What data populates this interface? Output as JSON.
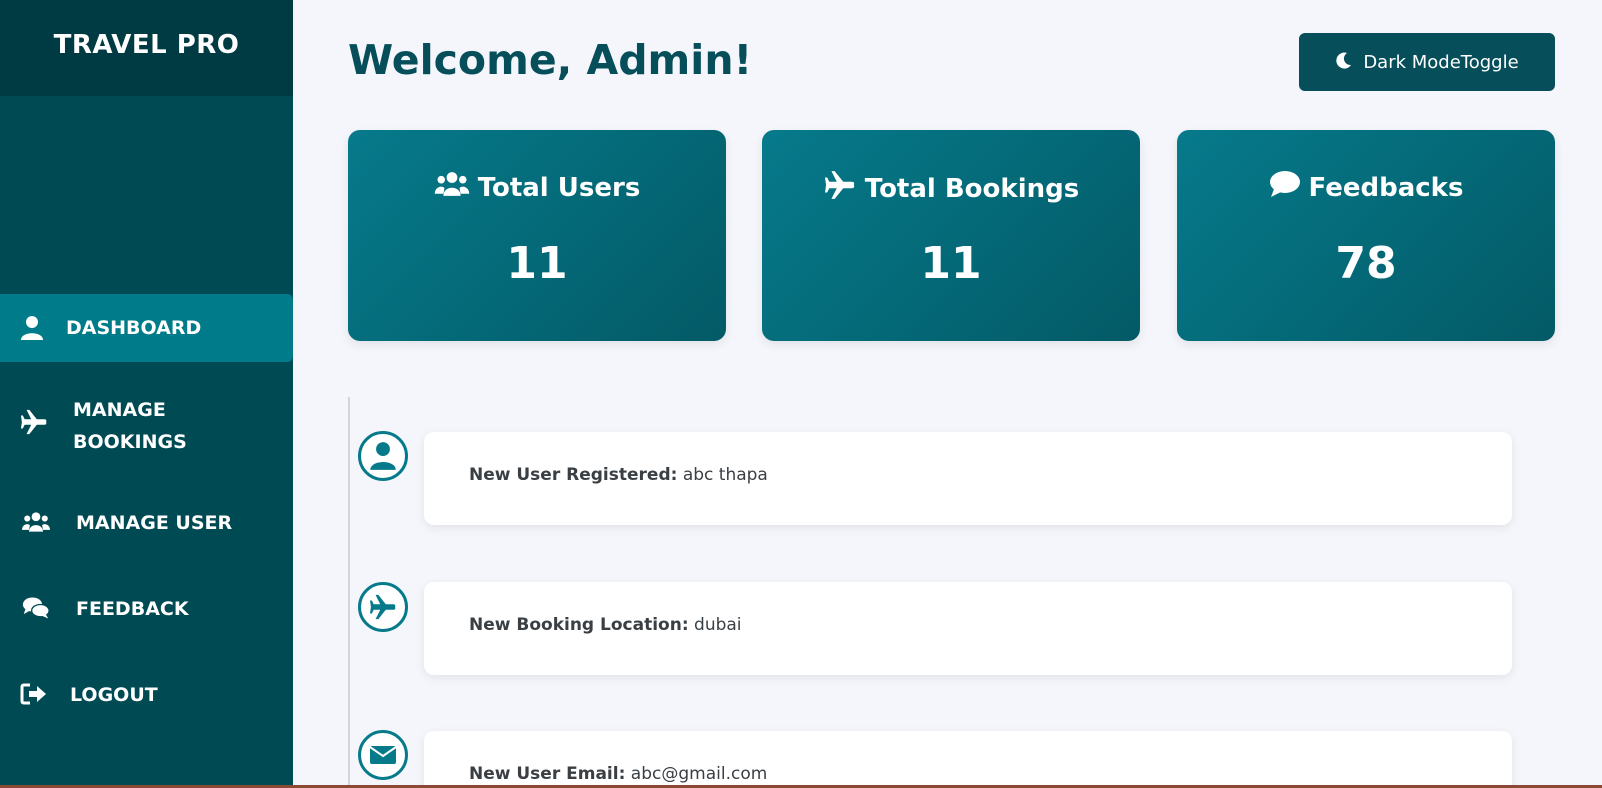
{
  "brand": {
    "name": "TRAVEL PRO"
  },
  "sidebar": {
    "items": [
      {
        "label": "DASHBOARD",
        "icon": "user-icon",
        "active": true
      },
      {
        "label": "MANAGE",
        "label2": "BOOKINGS",
        "icon": "plane-icon"
      },
      {
        "label": "MANAGE USER",
        "icon": "users-icon"
      },
      {
        "label": "FEEDBACK",
        "icon": "comments-icon"
      },
      {
        "label": "LOGOUT",
        "icon": "sign-out-icon"
      }
    ]
  },
  "header": {
    "welcome": "Welcome, Admin!",
    "toggle_label": "Dark ModeToggle",
    "toggle_icon": "moon-icon"
  },
  "stats": [
    {
      "title": "Total Users",
      "value": "11",
      "icon": "users-icon"
    },
    {
      "title": "Total Bookings",
      "value": "11",
      "icon": "plane-icon"
    },
    {
      "title": "Feedbacks",
      "value": "78",
      "icon": "comment-icon"
    }
  ],
  "activity": [
    {
      "label": "New User Registered:",
      "value": "abc thapa",
      "icon": "user-circle-icon"
    },
    {
      "label": "New Booking Location:",
      "value": "dubai",
      "icon": "plane-circle-icon"
    },
    {
      "label": "New User Email:",
      "value": "abc@gmail.com",
      "icon": "envelope-icon"
    }
  ],
  "colors": {
    "sidebar": "#004a54",
    "brand_bg": "#003a42",
    "active_item": "#007b8a",
    "accent": "#067a8b",
    "heading": "#064f5a",
    "background": "#f4f6fb"
  }
}
